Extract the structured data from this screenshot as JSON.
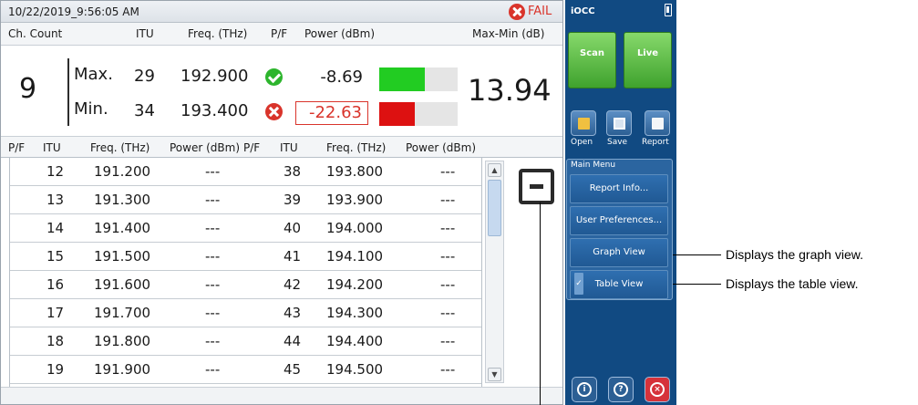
{
  "titlebar": {
    "timestamp": "10/22/2019_9:56:05 AM",
    "status": "FAIL",
    "status_color": "#d9342b",
    "status_icon": "fail-x-icon"
  },
  "summary_header": {
    "ch_count": "Ch. Count",
    "itu": "ITU",
    "freq": "Freq. (THz)",
    "pf": "P/F",
    "power": "Power (dBm)",
    "maxmin": "Max-Min (dB)"
  },
  "summary": {
    "channel_count": "9",
    "max": {
      "label": "Max.",
      "itu": "29",
      "freq": "192.900",
      "pf": "pass",
      "pf_icon": "check-icon",
      "power": "-8.69",
      "bar_fraction": 0.58,
      "bar_color": "#22cc22"
    },
    "min": {
      "label": "Min.",
      "itu": "34",
      "freq": "193.400",
      "pf": "fail",
      "pf_icon": "x-icon",
      "power": "-22.63",
      "bar_fraction": 0.45,
      "bar_color": "#dd1111"
    },
    "maxmin_value": "13.94"
  },
  "table_header": {
    "pf1": "P/F",
    "itu1": "ITU",
    "freq1": "Freq. (THz)",
    "power1": "Power (dBm)",
    "pf2": "P/F",
    "itu2": "ITU",
    "freq2": "Freq. (THz)",
    "power2": "Power (dBm)"
  },
  "table_rows": [
    {
      "itu1": "12",
      "freq1": "191.200",
      "pwr1": "---",
      "itu2": "38",
      "freq2": "193.800",
      "pwr2": "---"
    },
    {
      "itu1": "13",
      "freq1": "191.300",
      "pwr1": "---",
      "itu2": "39",
      "freq2": "193.900",
      "pwr2": "---"
    },
    {
      "itu1": "14",
      "freq1": "191.400",
      "pwr1": "---",
      "itu2": "40",
      "freq2": "194.000",
      "pwr2": "---"
    },
    {
      "itu1": "15",
      "freq1": "191.500",
      "pwr1": "---",
      "itu2": "41",
      "freq2": "194.100",
      "pwr2": "---"
    },
    {
      "itu1": "16",
      "freq1": "191.600",
      "pwr1": "---",
      "itu2": "42",
      "freq2": "194.200",
      "pwr2": "---"
    },
    {
      "itu1": "17",
      "freq1": "191.700",
      "pwr1": "---",
      "itu2": "43",
      "freq2": "194.300",
      "pwr2": "---"
    },
    {
      "itu1": "18",
      "freq1": "191.800",
      "pwr1": "---",
      "itu2": "44",
      "freq2": "194.400",
      "pwr2": "---"
    },
    {
      "itu1": "19",
      "freq1": "191.900",
      "pwr1": "---",
      "itu2": "45",
      "freq2": "194.500",
      "pwr2": "---"
    }
  ],
  "side": {
    "title": "iOCC",
    "scan_label": "Scan",
    "live_label": "Live",
    "accent_green": "#3fa22d",
    "panel_color": "#114a82",
    "open_label": "Open",
    "save_label": "Save",
    "report_label": "Report",
    "menu_title": "Main Menu",
    "menu_items": [
      "Report Info...",
      "User Preferences...",
      "Graph View",
      "Table View"
    ],
    "table_view_checked": true,
    "bottom_icons": [
      "info-icon",
      "help-icon",
      "close-icon"
    ]
  },
  "callouts": {
    "graph": "Displays the graph view.",
    "table": "Displays the table view."
  }
}
